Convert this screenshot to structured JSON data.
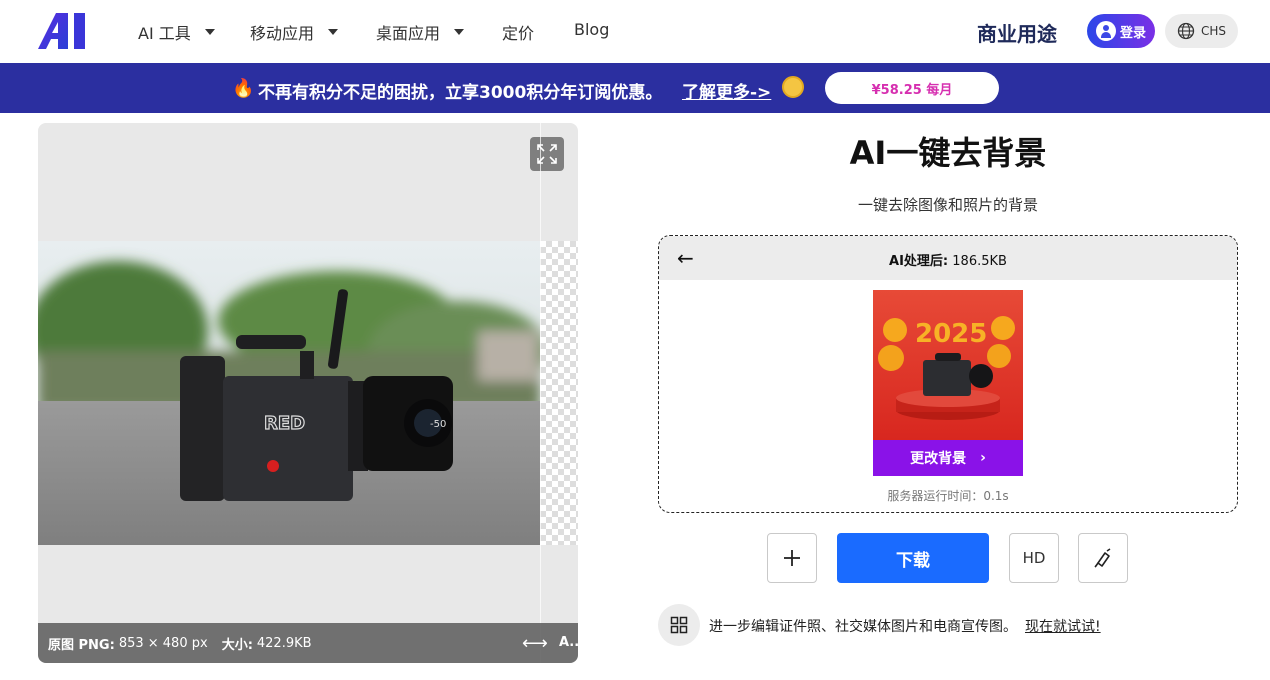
{
  "nav": {
    "items": [
      {
        "label": "AI 工具",
        "dropdown": true
      },
      {
        "label": "移动应用",
        "dropdown": true
      },
      {
        "label": "桌面应用",
        "dropdown": true
      },
      {
        "label": "定价",
        "dropdown": false
      },
      {
        "label": "Blog",
        "dropdown": false
      }
    ],
    "business_label": "商业用途",
    "login_label": "登录",
    "lang_label": "CHS"
  },
  "promo": {
    "text": "不再有积分不足的困扰，立享3000积分年订阅优惠。",
    "link": "了解更多->",
    "price": "¥58.25 每月"
  },
  "preview": {
    "info_prefix": "原图 PNG:",
    "dimensions": "853 × 480 px",
    "size_label": "大小:",
    "size_value": "422.9KB",
    "after_label": "A.."
  },
  "main": {
    "title": "AI一键去背景",
    "subtitle": "一键去除图像和照片的背景",
    "result_label": "AI处理后:",
    "result_size": "186.5KB",
    "thumb_text": "2025",
    "change_bg_label": "更改背景",
    "server_time": "服务器运行时间：0.1s",
    "download_label": "下载",
    "hd_label": "HD",
    "edit_promo": "进一步编辑证件照、社交媒体图片和电商宣传图。",
    "try_link": "现在就试试!"
  },
  "colors": {
    "brand_blue": "#1a6bff",
    "promo_bg": "#2b2fa0",
    "purple": "#8a12e8",
    "price_pink": "#d62fb0"
  }
}
